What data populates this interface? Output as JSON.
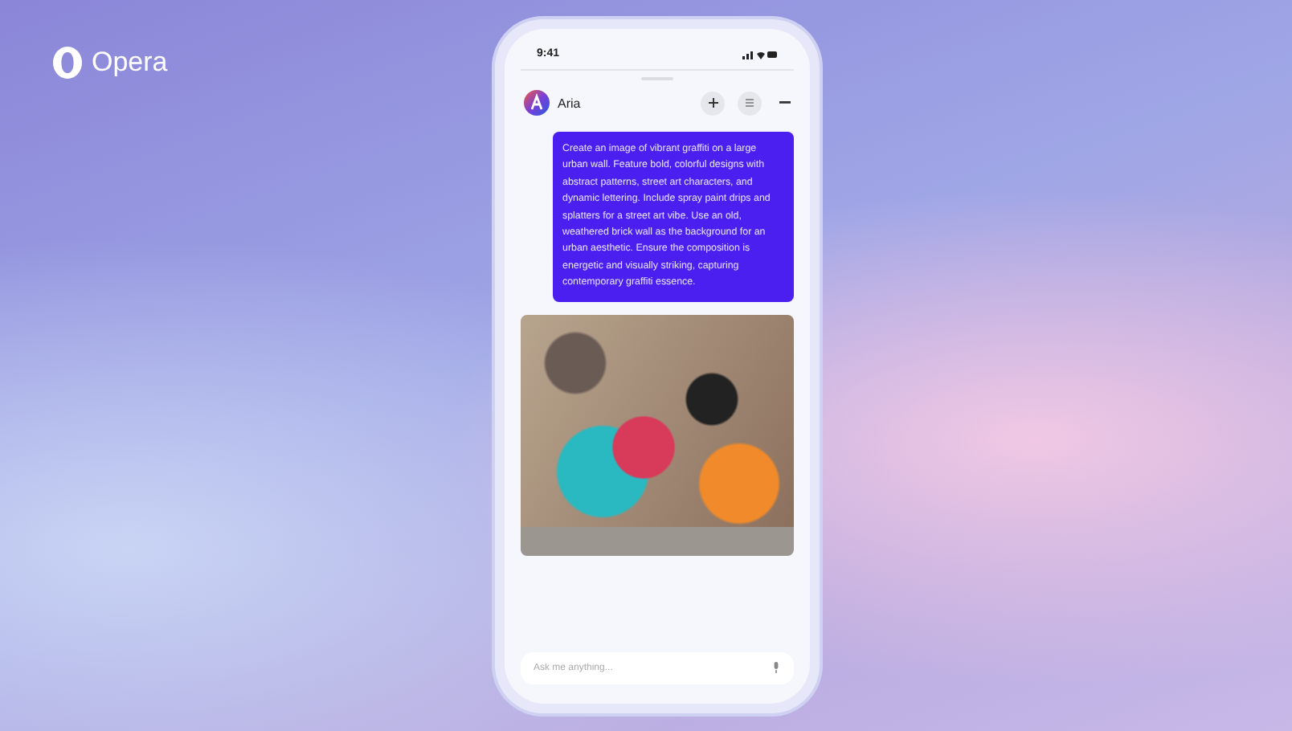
{
  "brand": {
    "name": "Opera"
  },
  "status_bar": {
    "time": "9:41"
  },
  "chat_header": {
    "name": "Aria"
  },
  "messages": [
    {
      "kind": "prompt",
      "text": "Create an image of vibrant graffiti on a large urban wall. Feature bold, colorful designs with abstract patterns, street art characters, and dynamic lettering. Include spray paint drips and splatters for a street art vibe. Use an old, weathered brick wall as the background for an urban aesthetic. Ensure the composition is energetic and visually striking, capturing contemporary graffiti essence."
    },
    {
      "kind": "image"
    }
  ],
  "input": {
    "placeholder": "Ask me anything..."
  }
}
